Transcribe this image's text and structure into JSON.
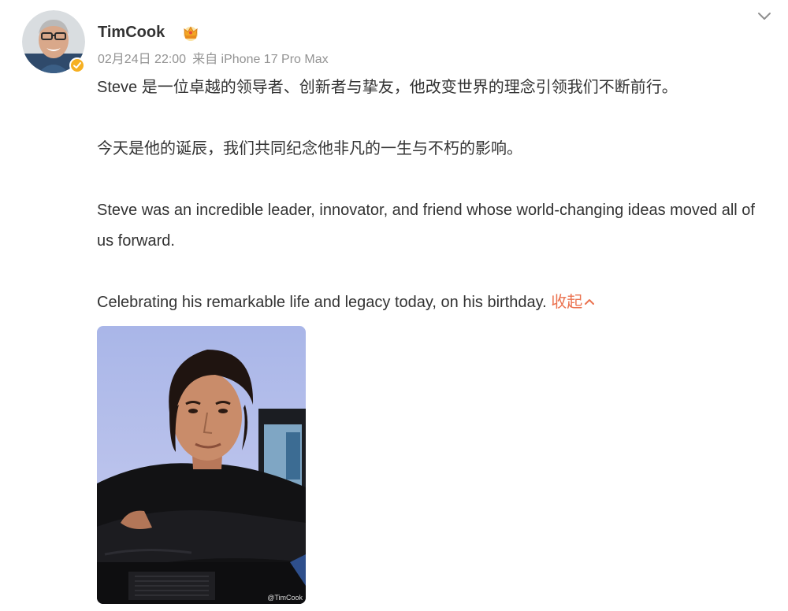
{
  "post": {
    "author": {
      "name": "TimCook"
    },
    "meta": {
      "timestamp": "02月24日 22:00",
      "source": "来自 iPhone 17 Pro Max"
    },
    "content": {
      "paragraphs": [
        "Steve 是一位卓越的领导者、创新者与挚友，他改变世界的理念引领我们不断前行。",
        "今天是他的诞辰，我们共同纪念他非凡的一生与不朽的影响。",
        "Steve was an incredible leader, innovator, and friend whose world-changing ideas moved all of us forward.",
        "Celebrating his remarkable life and legacy today, on his birthday."
      ],
      "collapse_label": "收起"
    },
    "image": {
      "watermark": "@TimCook"
    }
  },
  "icons": {
    "verified_badge": "verified-check-icon",
    "vip_badge": "crown-icon",
    "menu": "chevron-down-icon",
    "collapse": "chevron-up-icon"
  },
  "colors": {
    "link": "#eb7350",
    "meta_text": "#939393",
    "body_text": "#333333",
    "verified_badge": "#f6b022"
  }
}
